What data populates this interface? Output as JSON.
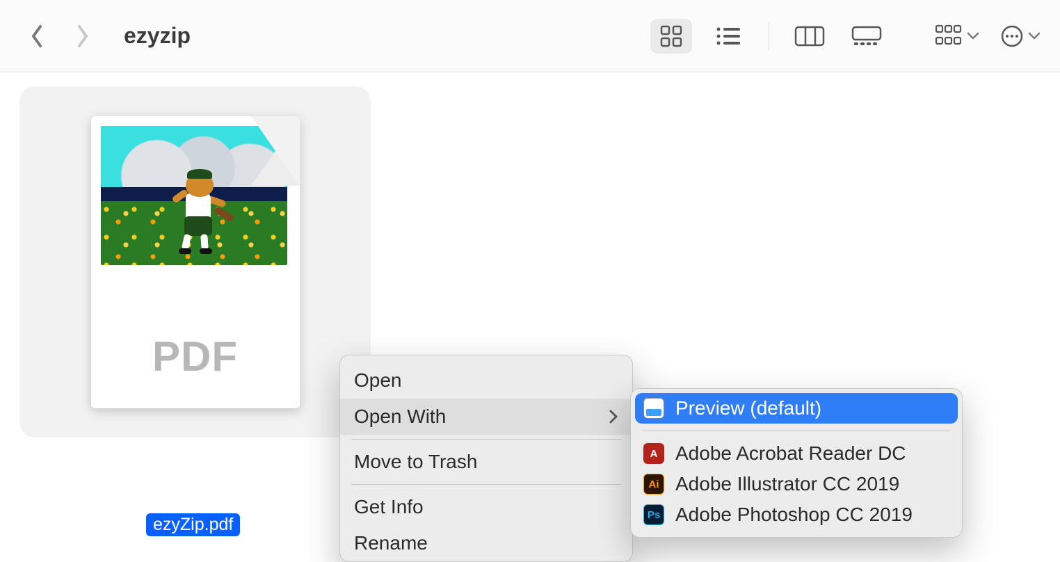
{
  "toolbar": {
    "title": "ezyzip"
  },
  "file": {
    "badge": "PDF",
    "name": "ezyZip.pdf"
  },
  "context_menu": {
    "items": [
      {
        "label": "Open"
      },
      {
        "label": "Open With",
        "submenu": true,
        "hover": true
      },
      {
        "label": "Move to Trash"
      },
      {
        "label": "Get Info"
      },
      {
        "label": "Rename"
      }
    ]
  },
  "submenu": {
    "items": [
      {
        "label": "Preview (default)",
        "icon": "preview",
        "selected": true
      },
      {
        "label": "Adobe Acrobat Reader DC",
        "icon": "acrobat"
      },
      {
        "label": "Adobe Illustrator CC 2019",
        "icon": "ai"
      },
      {
        "label": "Adobe Photoshop CC 2019",
        "icon": "ps"
      }
    ]
  }
}
